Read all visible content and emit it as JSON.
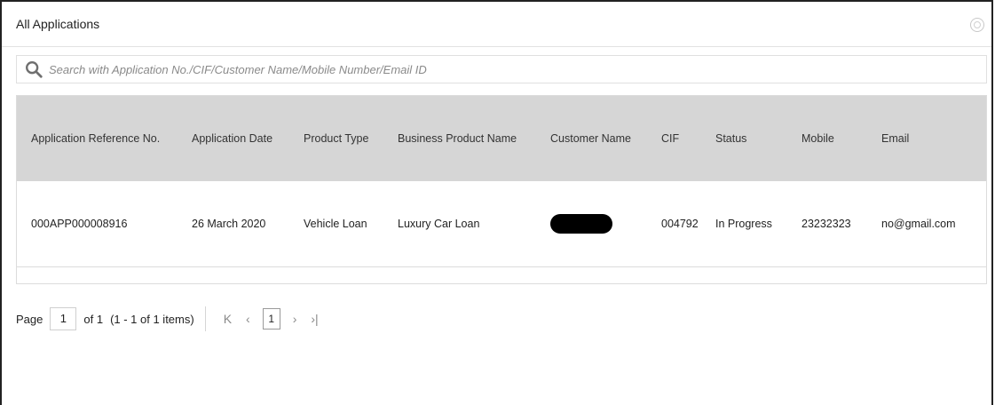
{
  "header": {
    "title": "All Applications",
    "help_icon": "help-circle-icon"
  },
  "search": {
    "placeholder": "Search with Application No./CIF/Customer Name/Mobile Number/Email ID",
    "value": "",
    "icon": "search-icon"
  },
  "table": {
    "columns": [
      "Application Reference No.",
      "Application Date",
      "Product Type",
      "Business Product Name",
      "Customer Name",
      "CIF",
      "Status",
      "Mobile",
      "Email"
    ],
    "rows": [
      {
        "ref_no": "000APP000008916",
        "date": "26 March 2020",
        "product_type": "Vehicle Loan",
        "business_product": "Luxury Car Loan",
        "customer_name": "",
        "cif": "004792",
        "status": "In Progress",
        "mobile": "23232323",
        "email": "no@gmail.com"
      }
    ]
  },
  "pager": {
    "page_label": "Page",
    "page_value": "1",
    "of_label": "of 1",
    "range_text": "(1 - 1 of 1 items)",
    "first_icon": "K",
    "prev_icon": "‹",
    "current_page": "1",
    "next_icon": "›",
    "last_icon": "›|"
  },
  "colors": {
    "header_bg": "#d6d6d6",
    "border": "#dcdcdc",
    "frame": "#222222"
  }
}
